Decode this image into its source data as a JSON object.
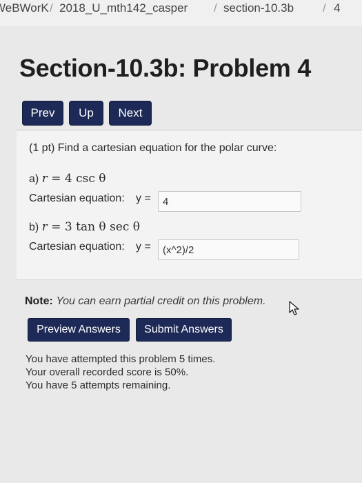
{
  "breadcrumb": {
    "items": [
      "WeBWorK",
      "2018_U_mth142_casper",
      "section-10.3b",
      "4"
    ],
    "separator": "/"
  },
  "page_title": "Section-10.3b: Problem 4",
  "nav": {
    "prev": "Prev",
    "up": "Up",
    "next": "Next"
  },
  "problem": {
    "intro": "(1 pt) Find a cartesian equation for the polar curve:",
    "part_a": {
      "label": "a)",
      "equation": {
        "lhs": "r",
        "rel": " = ",
        "rhs": "4 csc θ"
      },
      "answer_label": "Cartesian equation:",
      "answer_var": "y =",
      "answer_value": "4"
    },
    "part_b": {
      "label": "b)",
      "equation": {
        "lhs": "r",
        "rel": " = ",
        "rhs": "3 tan θ sec θ"
      },
      "answer_label": "Cartesian equation:",
      "answer_var": "y =",
      "answer_value": "(x^2)/2"
    }
  },
  "note": {
    "label": "Note:",
    "text": "You can earn partial credit on this problem."
  },
  "buttons": {
    "preview": "Preview Answers",
    "submit": "Submit Answers"
  },
  "status": {
    "attempts": "You have attempted this problem 5 times.",
    "score": "Your overall recorded score is 50%.",
    "remaining": "You have 5 attempts remaining."
  },
  "colors": {
    "button_bg": "#1d2a57",
    "page_bg": "#e9e9ea",
    "problem_bg": "#f3f3f3"
  },
  "icons": {
    "cursor": "mouse-pointer-icon"
  }
}
